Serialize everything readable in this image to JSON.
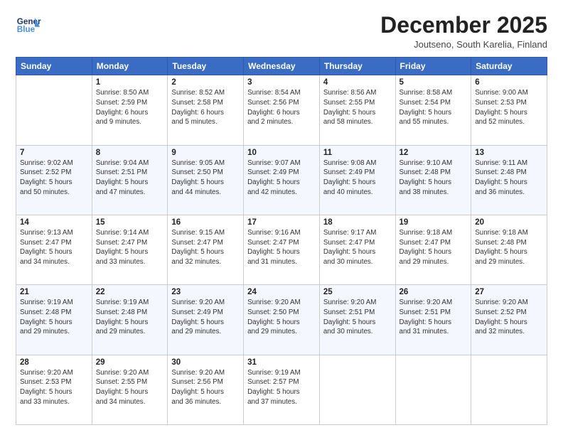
{
  "logo": {
    "line1": "General",
    "line2": "Blue"
  },
  "title": "December 2025",
  "location": "Joutseno, South Karelia, Finland",
  "days_header": [
    "Sunday",
    "Monday",
    "Tuesday",
    "Wednesday",
    "Thursday",
    "Friday",
    "Saturday"
  ],
  "weeks": [
    [
      {
        "day": "",
        "info": ""
      },
      {
        "day": "1",
        "info": "Sunrise: 8:50 AM\nSunset: 2:59 PM\nDaylight: 6 hours\nand 9 minutes."
      },
      {
        "day": "2",
        "info": "Sunrise: 8:52 AM\nSunset: 2:58 PM\nDaylight: 6 hours\nand 5 minutes."
      },
      {
        "day": "3",
        "info": "Sunrise: 8:54 AM\nSunset: 2:56 PM\nDaylight: 6 hours\nand 2 minutes."
      },
      {
        "day": "4",
        "info": "Sunrise: 8:56 AM\nSunset: 2:55 PM\nDaylight: 5 hours\nand 58 minutes."
      },
      {
        "day": "5",
        "info": "Sunrise: 8:58 AM\nSunset: 2:54 PM\nDaylight: 5 hours\nand 55 minutes."
      },
      {
        "day": "6",
        "info": "Sunrise: 9:00 AM\nSunset: 2:53 PM\nDaylight: 5 hours\nand 52 minutes."
      }
    ],
    [
      {
        "day": "7",
        "info": "Sunrise: 9:02 AM\nSunset: 2:52 PM\nDaylight: 5 hours\nand 50 minutes."
      },
      {
        "day": "8",
        "info": "Sunrise: 9:04 AM\nSunset: 2:51 PM\nDaylight: 5 hours\nand 47 minutes."
      },
      {
        "day": "9",
        "info": "Sunrise: 9:05 AM\nSunset: 2:50 PM\nDaylight: 5 hours\nand 44 minutes."
      },
      {
        "day": "10",
        "info": "Sunrise: 9:07 AM\nSunset: 2:49 PM\nDaylight: 5 hours\nand 42 minutes."
      },
      {
        "day": "11",
        "info": "Sunrise: 9:08 AM\nSunset: 2:49 PM\nDaylight: 5 hours\nand 40 minutes."
      },
      {
        "day": "12",
        "info": "Sunrise: 9:10 AM\nSunset: 2:48 PM\nDaylight: 5 hours\nand 38 minutes."
      },
      {
        "day": "13",
        "info": "Sunrise: 9:11 AM\nSunset: 2:48 PM\nDaylight: 5 hours\nand 36 minutes."
      }
    ],
    [
      {
        "day": "14",
        "info": "Sunrise: 9:13 AM\nSunset: 2:47 PM\nDaylight: 5 hours\nand 34 minutes."
      },
      {
        "day": "15",
        "info": "Sunrise: 9:14 AM\nSunset: 2:47 PM\nDaylight: 5 hours\nand 33 minutes."
      },
      {
        "day": "16",
        "info": "Sunrise: 9:15 AM\nSunset: 2:47 PM\nDaylight: 5 hours\nand 32 minutes."
      },
      {
        "day": "17",
        "info": "Sunrise: 9:16 AM\nSunset: 2:47 PM\nDaylight: 5 hours\nand 31 minutes."
      },
      {
        "day": "18",
        "info": "Sunrise: 9:17 AM\nSunset: 2:47 PM\nDaylight: 5 hours\nand 30 minutes."
      },
      {
        "day": "19",
        "info": "Sunrise: 9:18 AM\nSunset: 2:47 PM\nDaylight: 5 hours\nand 29 minutes."
      },
      {
        "day": "20",
        "info": "Sunrise: 9:18 AM\nSunset: 2:48 PM\nDaylight: 5 hours\nand 29 minutes."
      }
    ],
    [
      {
        "day": "21",
        "info": "Sunrise: 9:19 AM\nSunset: 2:48 PM\nDaylight: 5 hours\nand 29 minutes."
      },
      {
        "day": "22",
        "info": "Sunrise: 9:19 AM\nSunset: 2:48 PM\nDaylight: 5 hours\nand 29 minutes."
      },
      {
        "day": "23",
        "info": "Sunrise: 9:20 AM\nSunset: 2:49 PM\nDaylight: 5 hours\nand 29 minutes."
      },
      {
        "day": "24",
        "info": "Sunrise: 9:20 AM\nSunset: 2:50 PM\nDaylight: 5 hours\nand 29 minutes."
      },
      {
        "day": "25",
        "info": "Sunrise: 9:20 AM\nSunset: 2:51 PM\nDaylight: 5 hours\nand 30 minutes."
      },
      {
        "day": "26",
        "info": "Sunrise: 9:20 AM\nSunset: 2:51 PM\nDaylight: 5 hours\nand 31 minutes."
      },
      {
        "day": "27",
        "info": "Sunrise: 9:20 AM\nSunset: 2:52 PM\nDaylight: 5 hours\nand 32 minutes."
      }
    ],
    [
      {
        "day": "28",
        "info": "Sunrise: 9:20 AM\nSunset: 2:53 PM\nDaylight: 5 hours\nand 33 minutes."
      },
      {
        "day": "29",
        "info": "Sunrise: 9:20 AM\nSunset: 2:55 PM\nDaylight: 5 hours\nand 34 minutes."
      },
      {
        "day": "30",
        "info": "Sunrise: 9:20 AM\nSunset: 2:56 PM\nDaylight: 5 hours\nand 36 minutes."
      },
      {
        "day": "31",
        "info": "Sunrise: 9:19 AM\nSunset: 2:57 PM\nDaylight: 5 hours\nand 37 minutes."
      },
      {
        "day": "",
        "info": ""
      },
      {
        "day": "",
        "info": ""
      },
      {
        "day": "",
        "info": ""
      }
    ]
  ]
}
